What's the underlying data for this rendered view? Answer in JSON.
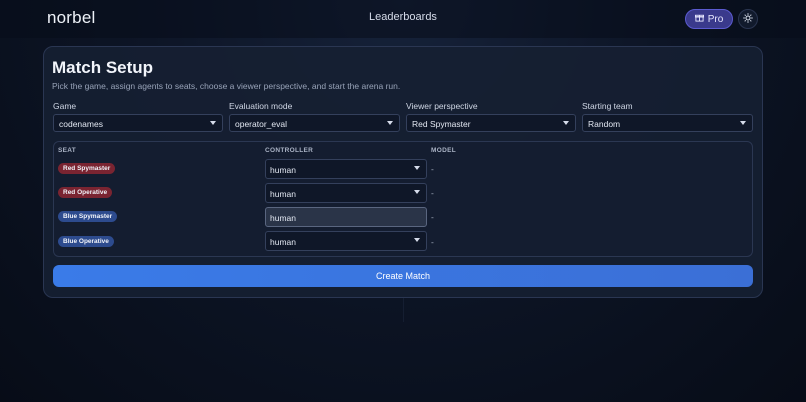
{
  "header": {
    "brand": "norbel",
    "nav_center": "Leaderboards",
    "pro_label": "Pro"
  },
  "page": {
    "title": "Match Setup",
    "subtitle": "Pick the game, assign agents to seats, choose a viewer perspective, and start the arena run."
  },
  "fields": {
    "game": {
      "label": "Game",
      "value": "codenames"
    },
    "evaluation_mode": {
      "label": "Evaluation mode",
      "value": "operator_eval"
    },
    "viewer_perspective": {
      "label": "Viewer perspective",
      "value": "Red Spymaster"
    },
    "starting_team": {
      "label": "Starting team",
      "value": "Random"
    }
  },
  "seats": {
    "headers": {
      "seat": "SEAT",
      "controller": "CONTROLLER",
      "model": "MODEL"
    },
    "rows": [
      {
        "seat": "Red Spymaster",
        "team": "red",
        "controller": "human",
        "model": "-"
      },
      {
        "seat": "Red Operative",
        "team": "red",
        "controller": "human",
        "model": "-"
      },
      {
        "seat": "Blue Spymaster",
        "team": "blue",
        "controller": "human",
        "model": "-"
      },
      {
        "seat": "Blue Operative",
        "team": "blue",
        "controller": "human",
        "model": "-"
      }
    ]
  },
  "actions": {
    "create_label": "Create Match"
  },
  "colors": {
    "accent": "#3a7be8",
    "pro": "#3a3a8c",
    "red_team": "#7a2431",
    "blue_team": "#2d4b8e"
  }
}
